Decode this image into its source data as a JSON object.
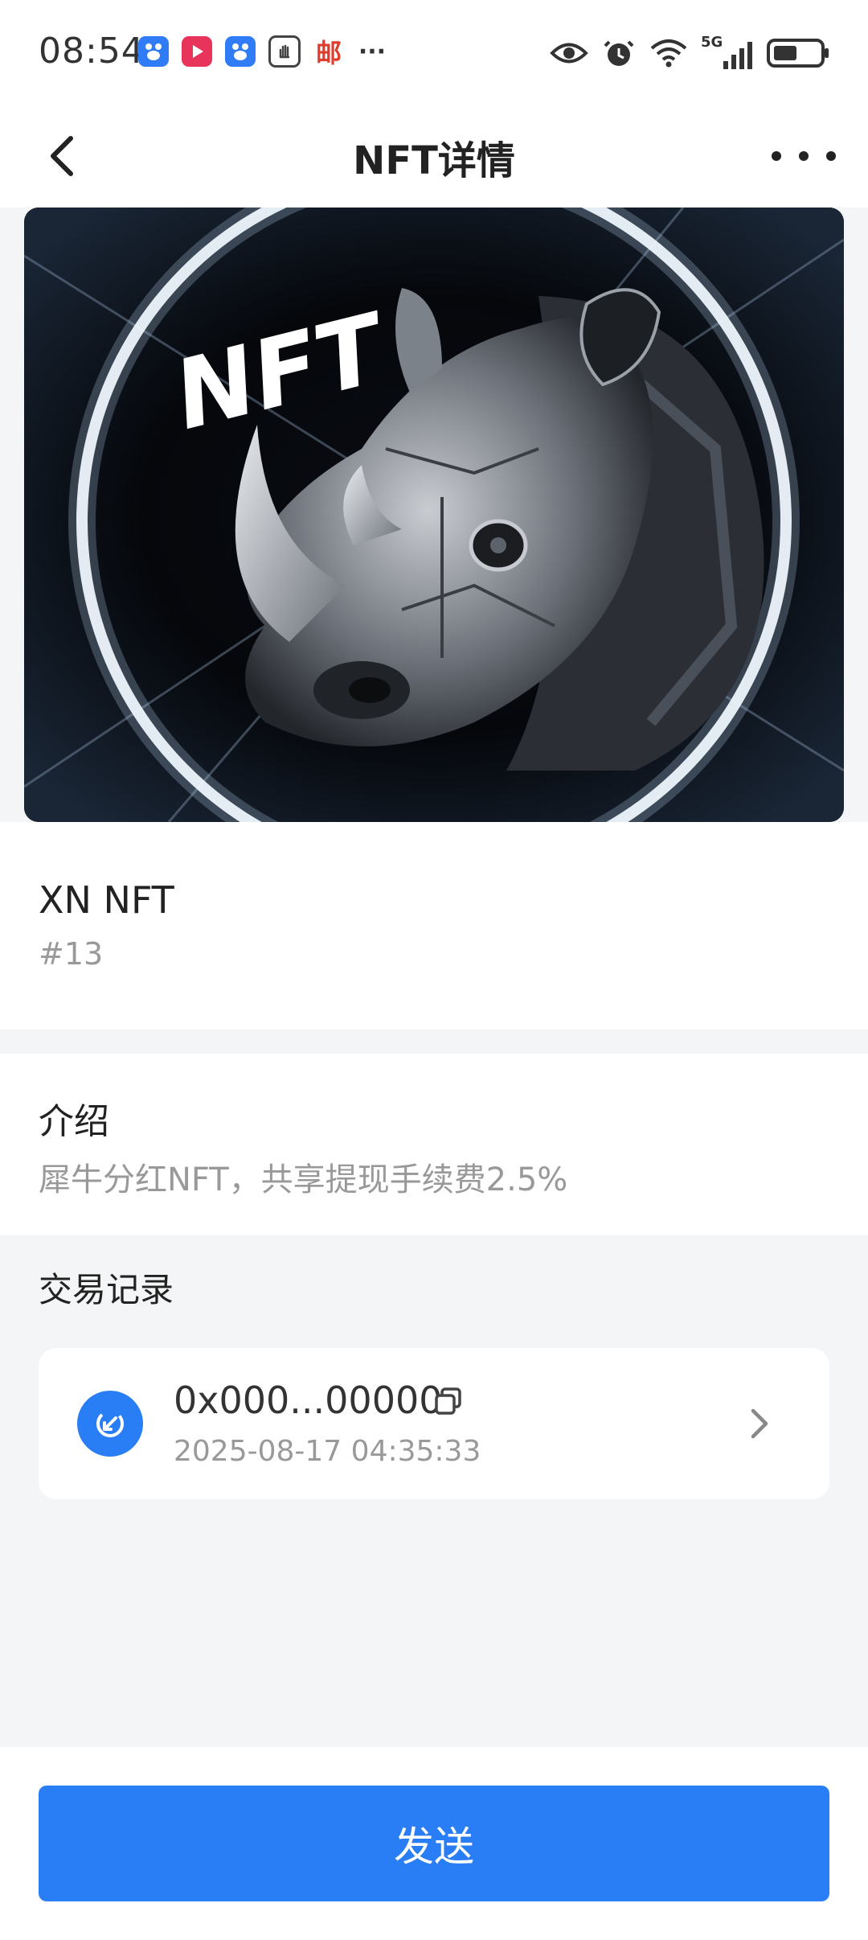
{
  "status_bar": {
    "time": "08:54",
    "icons": [
      "baidu-app-icon",
      "video-app-icon",
      "baidu-app-icon",
      "hand-app-icon",
      "mail-app-icon",
      "more-dots-icon",
      "eye-icon",
      "alarm-icon",
      "wifi-icon",
      "signal-5g-icon",
      "battery-icon"
    ],
    "mail_glyph": "邮",
    "more_glyph": "···",
    "network_label": "5G"
  },
  "nav": {
    "title": "NFT详情"
  },
  "hero": {
    "overlay_text": "NFT",
    "alt": "rhino-nft-artwork"
  },
  "nft": {
    "name": "XN NFT",
    "id": "#13"
  },
  "intro": {
    "title": "介绍",
    "text": "犀牛分红NFT，共享提现手续费2.5%"
  },
  "transactions": {
    "header": "交易记录",
    "items": [
      {
        "hash": "0x000...00000",
        "time": "2025-08-17 04:35:33"
      }
    ]
  },
  "actions": {
    "send_label": "发送"
  },
  "colors": {
    "accent": "#2a7ef5",
    "background": "#f4f5f7",
    "card": "#ffffff",
    "muted_text": "#999999"
  }
}
